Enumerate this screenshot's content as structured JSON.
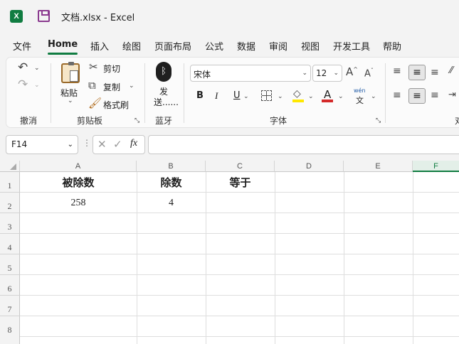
{
  "window": {
    "app_badge": "X",
    "title": "文档.xlsx  -  Excel"
  },
  "tabs": [
    {
      "label": "文件"
    },
    {
      "label": "Home"
    },
    {
      "label": "插入"
    },
    {
      "label": "绘图"
    },
    {
      "label": "页面布局"
    },
    {
      "label": "公式"
    },
    {
      "label": "数据"
    },
    {
      "label": "审阅"
    },
    {
      "label": "视图"
    },
    {
      "label": "开发工具"
    },
    {
      "label": "帮助"
    }
  ],
  "ribbon": {
    "undo_group": "撤消",
    "clipboard": {
      "paste": "粘贴",
      "cut": "剪切",
      "copy": "复制",
      "format_painter": "格式刷",
      "group": "剪贴板"
    },
    "bluetooth": {
      "send_line1": "发",
      "send_line2": "送......",
      "group": "蓝牙"
    },
    "font": {
      "name": "宋体",
      "size": "12",
      "bold": "B",
      "italic": "I",
      "underline": "U",
      "fill": "A",
      "group": "字体",
      "wen_top": "wén",
      "wen_bottom": "文"
    },
    "align_group_partial": "对"
  },
  "formula_bar": {
    "name_box": "F14",
    "fx": "fx",
    "formula": ""
  },
  "grid": {
    "columns": [
      "A",
      "B",
      "C",
      "D",
      "E",
      "F"
    ],
    "selected_column": "F",
    "rows": [
      "1",
      "2",
      "3",
      "4",
      "5",
      "6",
      "7",
      "8"
    ],
    "cells": {
      "A1": "被除数",
      "B1": "除数",
      "C1": "等于",
      "A2": "258",
      "B2": "4"
    }
  }
}
